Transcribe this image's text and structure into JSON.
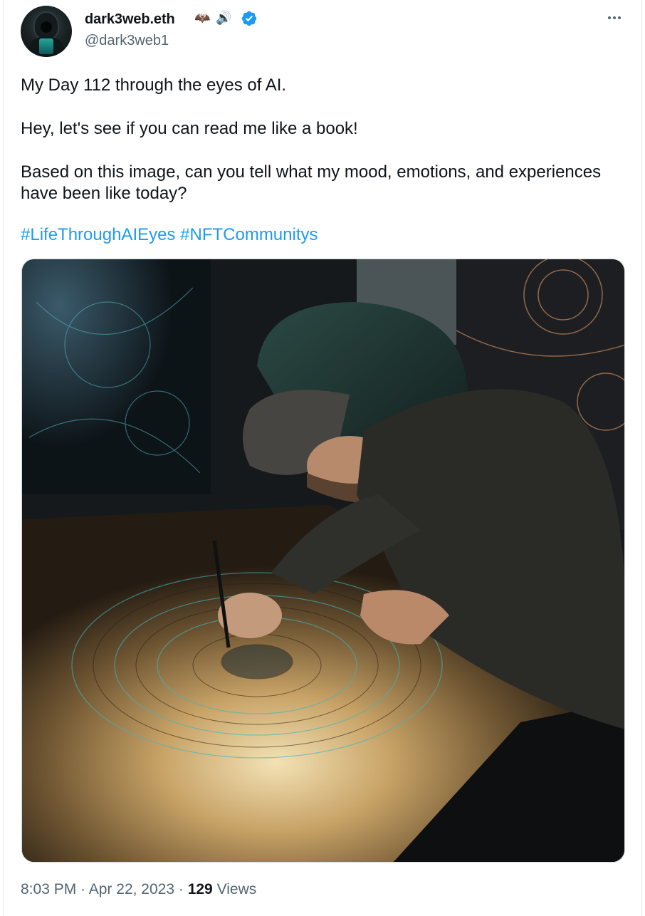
{
  "author": {
    "display_name": "dark3web.eth",
    "name_emojis": [
      "🦇",
      "🔊"
    ],
    "handle": "@dark3web1",
    "verified": true,
    "avatar_icon": "hooded-figure-avatar"
  },
  "tweet": {
    "lines": [
      "My Day 112 through the eyes of AI.",
      "Hey, let's see if you can read me like a book!",
      "Based on this image, can you tell what my mood, emotions, and experiences have been like today?"
    ],
    "hashtags": [
      "#LifeThroughAIEyes",
      "#NFTCommunitys"
    ]
  },
  "media": {
    "icon": "photo-man-in-green-hoodie-drawing-mandala"
  },
  "meta": {
    "time": "8:03 PM",
    "separator": "·",
    "date": "Apr 22, 2023",
    "views_count": "129",
    "views_label": "Views"
  },
  "colors": {
    "accent": "#1d9bf0",
    "secondary_text": "#536471",
    "primary_text": "#0f1419"
  }
}
